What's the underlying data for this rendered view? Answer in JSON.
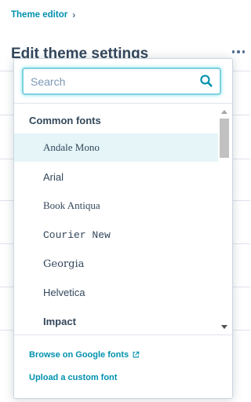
{
  "breadcrumb": {
    "label": "Theme editor",
    "chevron": "›"
  },
  "page": {
    "title": "Edit theme settings"
  },
  "dropdown": {
    "search": {
      "placeholder": "Search",
      "value": ""
    },
    "group_label": "Common fonts",
    "fonts": [
      {
        "label": "Andale Mono",
        "family": "\"Liberation Serif\", serif",
        "weight": "normal",
        "highlighted": true
      },
      {
        "label": "Arial",
        "family": "\"Liberation Sans\", sans-serif",
        "weight": "normal",
        "highlighted": false
      },
      {
        "label": "Book Antiqua",
        "family": "\"Liberation Serif\", serif",
        "weight": "normal",
        "highlighted": false
      },
      {
        "label": "Courier New",
        "family": "\"Liberation Mono\", monospace",
        "weight": "normal",
        "highlighted": false
      },
      {
        "label": "Georgia",
        "family": "\"DejaVu Serif\", serif",
        "weight": "normal",
        "highlighted": false
      },
      {
        "label": "Helvetica",
        "family": "\"Liberation Sans\", sans-serif",
        "weight": "normal",
        "highlighted": false
      },
      {
        "label": "Impact",
        "family": "\"Liberation Sans\", sans-serif",
        "weight": "bold",
        "highlighted": false
      }
    ],
    "footer": {
      "google_link": "Browse on Google fonts",
      "upload_link": "Upload a custom font"
    }
  },
  "colors": {
    "link": "#0091ae",
    "text": "#33475b",
    "focus": "#7fd1de",
    "highlight": "#e5f5f8"
  },
  "icons": {
    "search": "search-icon",
    "more": "more-horizontal-icon",
    "external": "external-link-icon"
  }
}
